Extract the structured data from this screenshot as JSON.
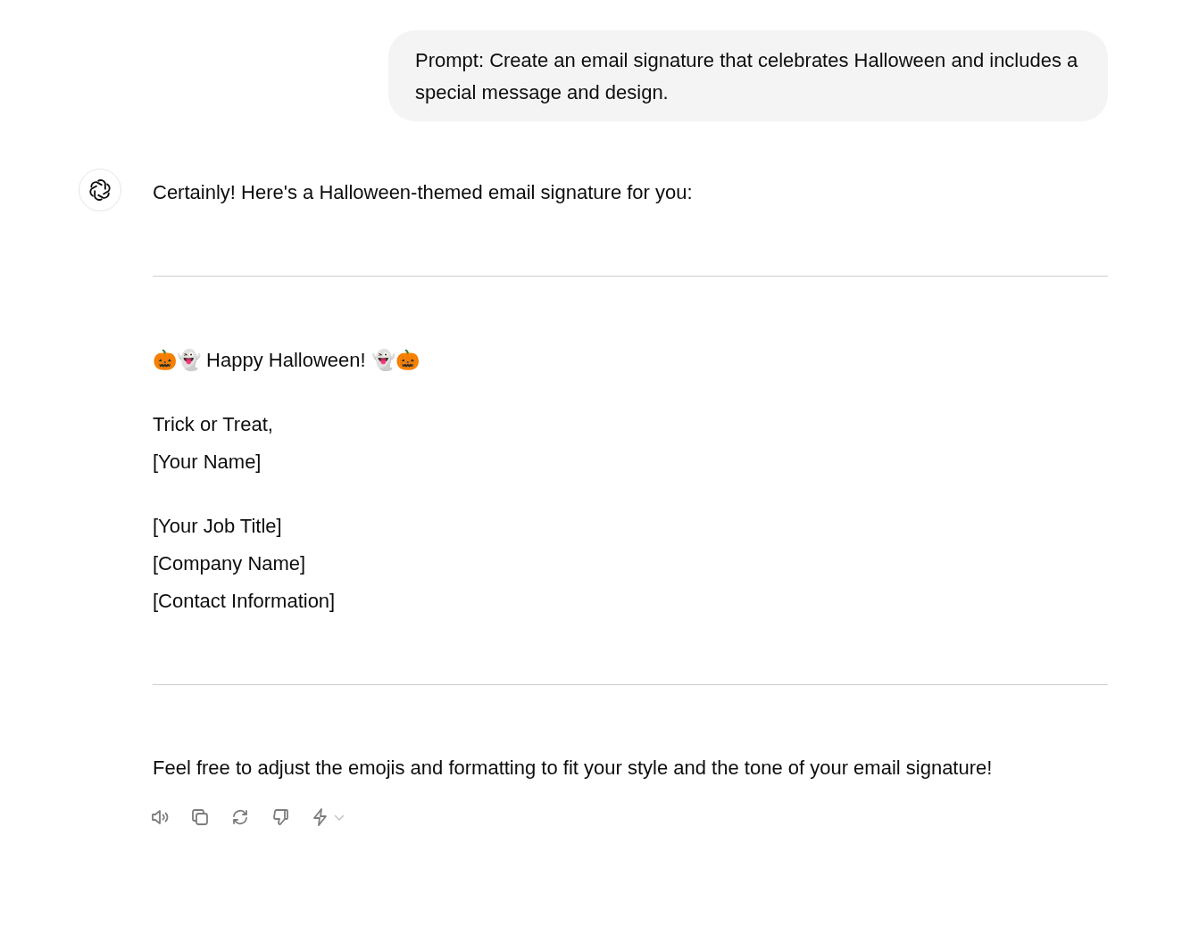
{
  "user_message": {
    "text": "Prompt: Create an email signature that celebrates Halloween and includes a special message and design."
  },
  "assistant_message": {
    "intro": "Certainly! Here's a Halloween-themed email signature for you:",
    "signature": {
      "heading": "🎃👻 Happy Halloween! 👻🎃",
      "closing": [
        "Trick or Treat,",
        "[Your Name]"
      ],
      "details": [
        "[Your Job Title]",
        "[Company Name]",
        "[Contact Information]"
      ]
    },
    "outro": "Feel free to adjust the emojis and formatting to fit your style and the tone of your email signature!",
    "actions": [
      {
        "kind": "read-aloud"
      },
      {
        "kind": "copy"
      },
      {
        "kind": "regenerate"
      },
      {
        "kind": "dislike"
      },
      {
        "kind": "model-switch"
      }
    ]
  }
}
